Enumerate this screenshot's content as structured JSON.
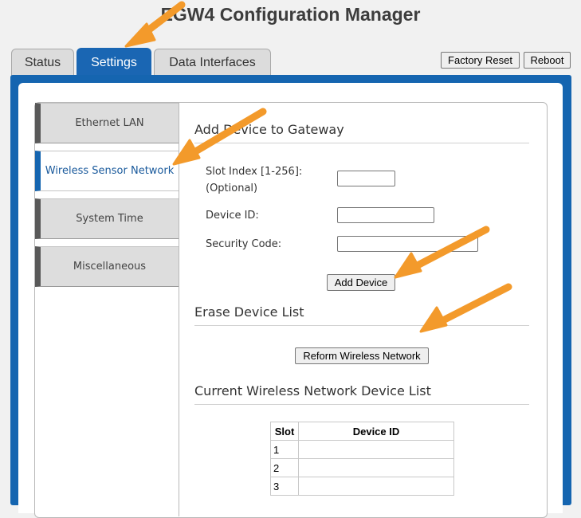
{
  "page": {
    "title": "EGW4 Configuration Manager"
  },
  "top_tabs": [
    {
      "label": "Status",
      "active": false
    },
    {
      "label": "Settings",
      "active": true
    },
    {
      "label": "Data Interfaces",
      "active": false
    }
  ],
  "header_buttons": {
    "factory_reset": "Factory Reset",
    "reboot": "Reboot"
  },
  "sidebar": {
    "items": [
      {
        "label": "Ethernet LAN",
        "active": false
      },
      {
        "label": "Wireless Sensor Network",
        "active": true
      },
      {
        "label": "System Time",
        "active": false
      },
      {
        "label": "Miscellaneous",
        "active": false
      }
    ]
  },
  "add_device": {
    "heading": "Add Device to Gateway",
    "slot_label_line1": "Slot Index [1-256]:",
    "slot_label_line2": "(Optional)",
    "slot_value": "",
    "device_id_label": "Device ID:",
    "device_id_value": "",
    "security_code_label": "Security Code:",
    "security_code_value": "",
    "button": "Add Device"
  },
  "erase": {
    "heading": "Erase Device List",
    "button": "Reform Wireless Network"
  },
  "device_list": {
    "heading": "Current Wireless Network Device List",
    "columns": [
      "Slot",
      "Device ID"
    ],
    "rows": [
      {
        "slot": "1",
        "device_id": ""
      },
      {
        "slot": "2",
        "device_id": ""
      },
      {
        "slot": "3",
        "device_id": ""
      }
    ]
  },
  "colors": {
    "accent": "#1565b0",
    "annotation_arrow": "#f39a2b"
  }
}
